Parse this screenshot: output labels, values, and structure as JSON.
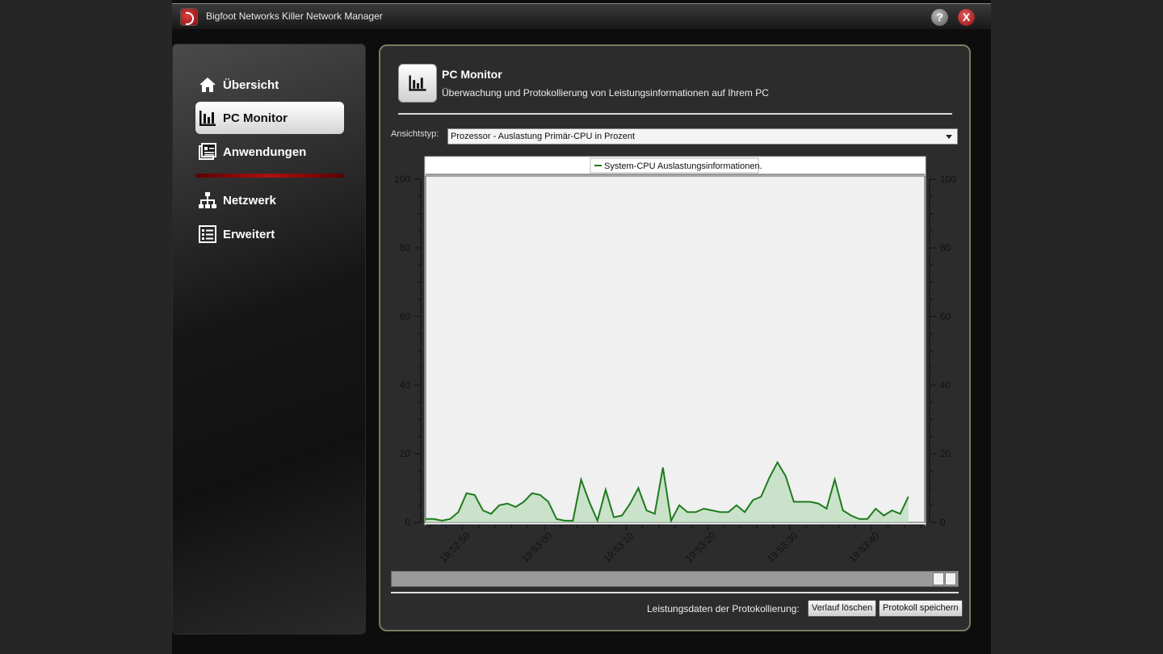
{
  "window": {
    "title": "Bigfoot Networks Killer Network Manager",
    "help_label": "?",
    "close_label": "X"
  },
  "sidebar": {
    "items": [
      {
        "label": "Übersicht",
        "icon": "home-icon"
      },
      {
        "label": "PC Monitor",
        "icon": "bar-chart-icon",
        "active": true
      },
      {
        "label": "Anwendungen",
        "icon": "applications-icon"
      },
      {
        "label": "Netzwerk",
        "icon": "network-icon"
      },
      {
        "label": "Erweitert",
        "icon": "list-icon"
      }
    ]
  },
  "header": {
    "title": "PC Monitor",
    "subtitle": "Überwachung und Protokollierung von Leistungsinformationen auf Ihrem PC"
  },
  "view": {
    "label": "Ansichtstyp:",
    "selected": "Prozessor - Auslastung Primär-CPU in Prozent"
  },
  "footer": {
    "log_label": "Leistungsdaten der Protokollierung:",
    "clear_button": "Verlauf löschen",
    "save_button": "Protokoll speichern"
  },
  "colors": {
    "accent_red": "#b01010",
    "series_line": "#1e7a1e",
    "series_fill": "#b8dcb8",
    "plot_bg": "#f0f0f0"
  },
  "chart_data": {
    "type": "area",
    "title": "",
    "xlabel": "",
    "ylabel": "",
    "ylim": [
      0,
      100
    ],
    "yticks": [
      0,
      20,
      40,
      60,
      80,
      100
    ],
    "xlim": [
      0,
      61
    ],
    "xtick_labels": [
      "19:52:50",
      "19:53:00",
      "19:53:10",
      "19:53:20",
      "19:53:30",
      "19:53:40"
    ],
    "xtick_positions": [
      5.5,
      15.5,
      25.5,
      35.5,
      45.5,
      55.5
    ],
    "legend": "top",
    "grid": false,
    "series": [
      {
        "name": "System-CPU Auslastungsinformationen.",
        "values": [
          1,
          1,
          0.5,
          1,
          3,
          8.5,
          8,
          3.5,
          2.5,
          5,
          5.5,
          4.5,
          6,
          8.5,
          8,
          6,
          1,
          0.5,
          0.5,
          12.5,
          6,
          0.5,
          9.5,
          1.5,
          2,
          5.5,
          10,
          3.5,
          2.5,
          16,
          0.5,
          5,
          3,
          3,
          4,
          3.5,
          3,
          3,
          5,
          3,
          6.5,
          7.5,
          13,
          17.5,
          13.5,
          6,
          6,
          6,
          5.5,
          4,
          12.5,
          3.5,
          2,
          1,
          1,
          4,
          2,
          3.5,
          2.5,
          7.5
        ]
      }
    ]
  }
}
